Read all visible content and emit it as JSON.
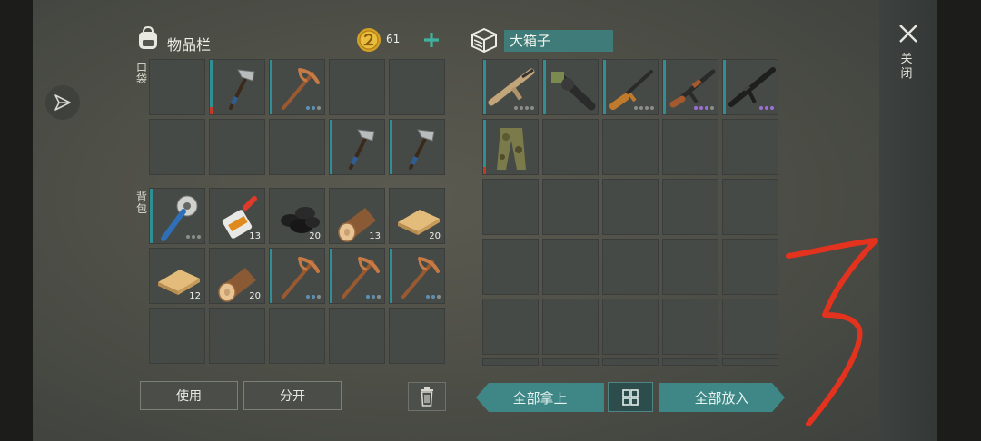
{
  "inventory": {
    "title": "物品栏",
    "coins": "61",
    "pocket_label": "口袋",
    "backpack_label": "背包",
    "pocket": [
      {
        "icon": "",
        "count": "",
        "dots": []
      },
      {
        "icon": "hatchet",
        "count": "",
        "dots": [],
        "teal": true,
        "redbar": true
      },
      {
        "icon": "pickaxe",
        "count": "",
        "dots": [
          "#5e8fb3",
          "#5e8fb3",
          "#8a8d8a"
        ],
        "teal": true
      },
      {
        "icon": "",
        "count": "",
        "dots": []
      },
      {
        "icon": "",
        "count": "",
        "dots": []
      },
      {
        "icon": "",
        "count": "",
        "dots": []
      },
      {
        "icon": "",
        "count": "",
        "dots": []
      },
      {
        "icon": "",
        "count": "",
        "dots": []
      },
      {
        "icon": "hatchet",
        "count": "",
        "dots": [],
        "teal": true
      },
      {
        "icon": "hatchet",
        "count": "",
        "dots": [],
        "teal": true
      }
    ],
    "backpack": [
      {
        "icon": "sawblade-mace",
        "count": "",
        "dots": [
          "#8a8d8a",
          "#8a8d8a",
          "#8a8d8a"
        ],
        "teal": true
      },
      {
        "icon": "glue",
        "count": "13",
        "dots": []
      },
      {
        "icon": "coal",
        "count": "20",
        "dots": []
      },
      {
        "icon": "log",
        "count": "13",
        "dots": []
      },
      {
        "icon": "plank",
        "count": "20",
        "dots": []
      },
      {
        "icon": "plank",
        "count": "12",
        "dots": []
      },
      {
        "icon": "log",
        "count": "20",
        "dots": []
      },
      {
        "icon": "pickaxe",
        "count": "",
        "dots": [
          "#5e8fb3",
          "#5e8fb3",
          "#8a8d8a"
        ],
        "teal": true
      },
      {
        "icon": "pickaxe",
        "count": "",
        "dots": [
          "#5e8fb3",
          "#5e8fb3",
          "#8a8d8a"
        ],
        "teal": true
      },
      {
        "icon": "pickaxe",
        "count": "",
        "dots": [
          "#5e8fb3",
          "#5e8fb3",
          "#8a8d8a"
        ],
        "teal": true
      },
      {
        "icon": "",
        "count": "",
        "dots": []
      },
      {
        "icon": "",
        "count": "",
        "dots": []
      },
      {
        "icon": "",
        "count": "",
        "dots": []
      },
      {
        "icon": "",
        "count": "",
        "dots": []
      },
      {
        "icon": "",
        "count": "",
        "dots": []
      }
    ],
    "use_label": "使用",
    "split_label": "分开"
  },
  "chest": {
    "title": "大箱子",
    "items": [
      {
        "icon": "rifle-tan",
        "dots": [
          "#8a8d8a",
          "#8a8d8a",
          "#8a8d8a",
          "#8a8d8a"
        ],
        "teal": true
      },
      {
        "icon": "minigun",
        "dots": [],
        "teal": true
      },
      {
        "icon": "rifle-wood",
        "dots": [
          "#8a8d8a",
          "#8a8d8a",
          "#8a8d8a",
          "#8a8d8a"
        ],
        "teal": true
      },
      {
        "icon": "ak",
        "dots": [
          "#9b6fd6",
          "#9b6fd6",
          "#9b6fd6",
          "#8a8d8a"
        ],
        "teal": true
      },
      {
        "icon": "m4",
        "dots": [
          "#9b6fd6",
          "#9b6fd6",
          "#9b6fd6"
        ],
        "teal": true
      },
      {
        "icon": "camo-pants",
        "dots": [],
        "teal": true,
        "redbar": true
      }
    ],
    "take_all_label": "全部拿上",
    "put_all_label": "全部放入"
  },
  "close_label": "关闭",
  "colors": {
    "accent": "#3e8786",
    "scribble": "#e3321d"
  }
}
